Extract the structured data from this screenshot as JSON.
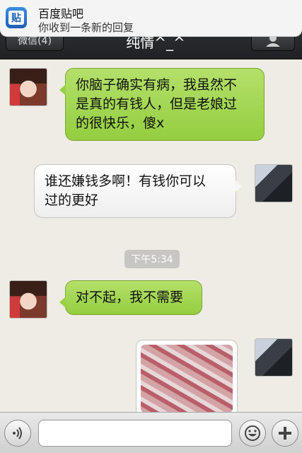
{
  "notification": {
    "app_icon_char": "贴",
    "title": "百度贴吧",
    "message": "你收到一条新的回复"
  },
  "navbar": {
    "back_label": "微信(4)",
    "chat_title": "纯情^_^"
  },
  "messages": [
    {
      "side": "left",
      "text_lines": [
        "你脑子确实有病，我虽然不",
        "是真的有钱人，但是老娘过",
        "的很快乐，傻x"
      ]
    },
    {
      "side": "right",
      "text_lines": [
        "谁还嫌钱多啊！有钱你可以",
        "过的更好"
      ]
    },
    {
      "timestamp": "下午5:34"
    },
    {
      "side": "left",
      "text_lines": [
        "对不起，我不需要"
      ]
    },
    {
      "side": "right",
      "type": "image"
    }
  ],
  "input_bar": {
    "voice_icon": "voice-icon",
    "emoji_icon": "emoji-icon",
    "plus_icon": "plus-icon",
    "placeholder": ""
  },
  "colors": {
    "green_bubble": "#a6d856",
    "white_bubble": "#ffffff",
    "navbar": "#2b2d2f",
    "chat_bg": "#efece6"
  }
}
